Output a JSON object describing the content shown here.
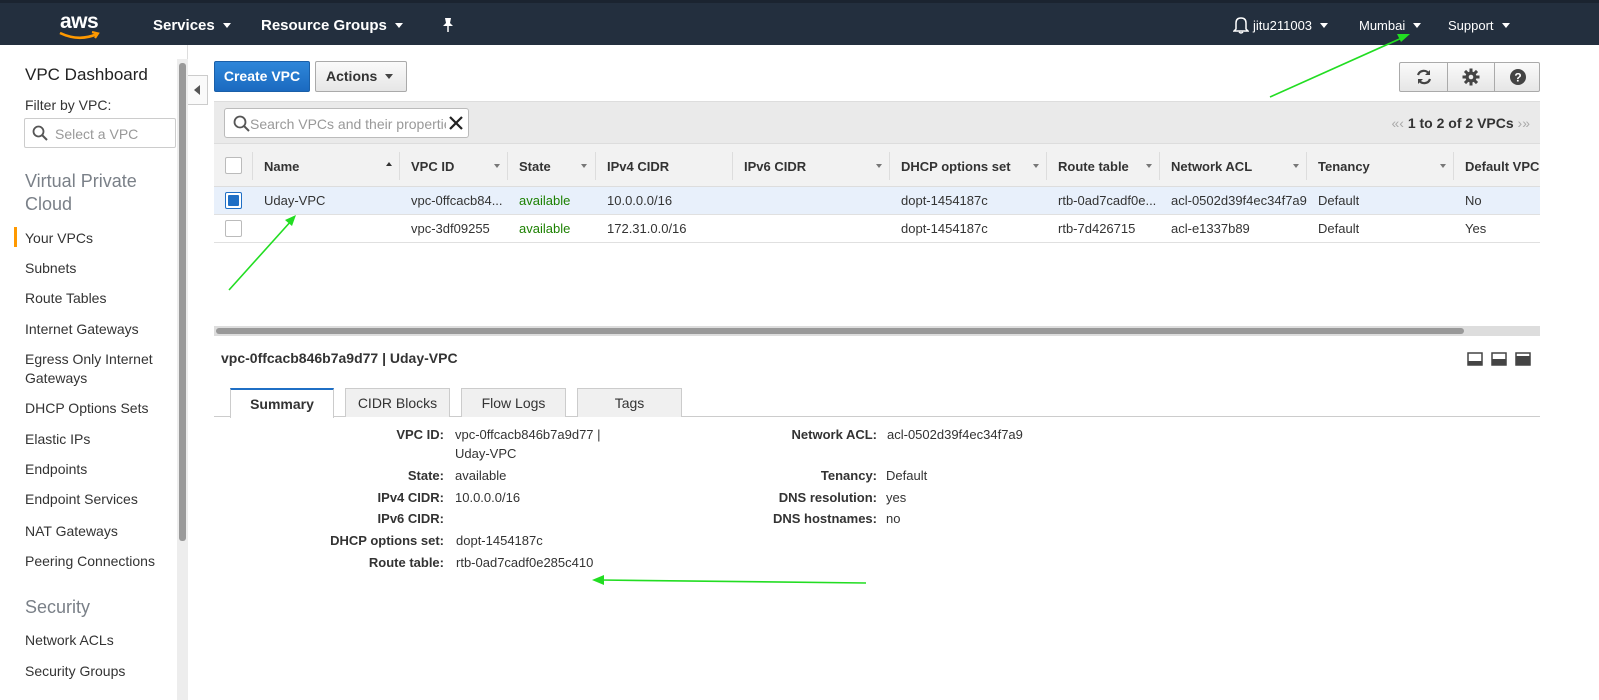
{
  "topnav": {
    "logo": "aws",
    "services": "Services",
    "resource_groups": "Resource Groups",
    "user": "jitu211003",
    "region": "Mumbai",
    "support": "Support"
  },
  "sidebar": {
    "title": "VPC Dashboard",
    "filter_label": "Filter by VPC:",
    "filter_placeholder": "Select a VPC",
    "section_vpc": "Virtual Private Cloud",
    "items": [
      "Your VPCs",
      "Subnets",
      "Route Tables",
      "Internet Gateways",
      "Egress Only Internet Gateways",
      "DHCP Options Sets",
      "Elastic IPs",
      "Endpoints",
      "Endpoint Services",
      "NAT Gateways",
      "Peering Connections"
    ],
    "section_security": "Security",
    "security_items": [
      "Network ACLs",
      "Security Groups"
    ]
  },
  "toolbar": {
    "create": "Create VPC",
    "actions": "Actions"
  },
  "filter": {
    "placeholder": "Search VPCs and their properties",
    "pager": "1 to 2 of 2 VPCs"
  },
  "table": {
    "columns": [
      "Name",
      "VPC ID",
      "State",
      "IPv4 CIDR",
      "IPv6 CIDR",
      "DHCP options set",
      "Route table",
      "Network ACL",
      "Tenancy",
      "Default VPC"
    ],
    "rows": [
      {
        "name": "Uday-VPC",
        "vpc_id": "vpc-0ffcacb84...",
        "state": "available",
        "ipv4": "10.0.0.0/16",
        "ipv6": "",
        "dhcp": "dopt-1454187c",
        "route": "rtb-0ad7cadf0e...",
        "acl": "acl-0502d39f4ec34f7a9",
        "tenancy": "Default",
        "default": "No",
        "selected": true
      },
      {
        "name": "",
        "vpc_id": "vpc-3df09255",
        "state": "available",
        "ipv4": "172.31.0.0/16",
        "ipv6": "",
        "dhcp": "dopt-1454187c",
        "route": "rtb-7d426715",
        "acl": "acl-e1337b89",
        "tenancy": "Default",
        "default": "Yes",
        "selected": false
      }
    ]
  },
  "detail": {
    "title": "vpc-0ffcacb846b7a9d77 | Uday-VPC",
    "tabs": [
      "Summary",
      "CIDR Blocks",
      "Flow Logs",
      "Tags"
    ],
    "left": {
      "vpc_id_label": "VPC ID:",
      "vpc_id_line1": "vpc-0ffcacb846b7a9d77 |",
      "vpc_id_line2": "Uday-VPC",
      "state_label": "State:",
      "state": "available",
      "ipv4_label": "IPv4 CIDR:",
      "ipv4": "10.0.0.0/16",
      "ipv6_label": "IPv6 CIDR:",
      "ipv6": "",
      "dhcp_label": "DHCP options set:",
      "dhcp": "dopt-1454187c",
      "route_label": "Route table:",
      "route": "rtb-0ad7cadf0e285c410"
    },
    "right": {
      "acl_label": "Network ACL:",
      "acl": "acl-0502d39f4ec34f7a9",
      "tenancy_label": "Tenancy:",
      "tenancy": "Default",
      "dns_res_label": "DNS resolution:",
      "dns_res": "yes",
      "dns_host_label": "DNS hostnames:",
      "dns_host": "no"
    }
  },
  "colors": {
    "nav_bg": "#232f3e",
    "primary": "#1f6fc5",
    "accent": "#ff9900",
    "available": "#1d8102",
    "link": "#1166bb",
    "annotation": "#00e000"
  }
}
